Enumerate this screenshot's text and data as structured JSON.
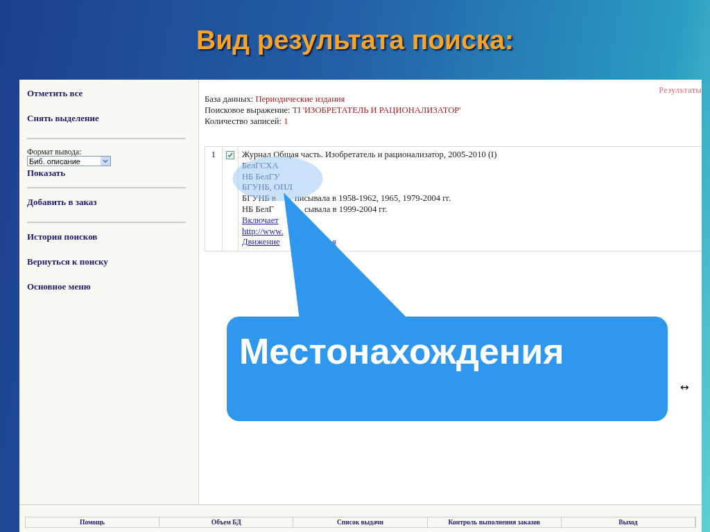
{
  "slide": {
    "title": "Вид результата поиска:"
  },
  "sidebar": {
    "items": [
      {
        "kind": "link",
        "label": "Отметить все"
      },
      {
        "kind": "link",
        "label": "Снять выделение"
      },
      {
        "kind": "divider"
      },
      {
        "kind": "select",
        "label": "Формат вывода:",
        "value": "Биб. описание"
      },
      {
        "kind": "action",
        "label": "Показать"
      },
      {
        "kind": "divider"
      },
      {
        "kind": "link",
        "label": "Добавить в заказ"
      },
      {
        "kind": "divider"
      },
      {
        "kind": "link",
        "label": "История поисков"
      },
      {
        "kind": "link",
        "label": "Вернуться к поиску"
      },
      {
        "kind": "link",
        "label": "Основное меню"
      }
    ]
  },
  "main": {
    "corner_link": "Результаты",
    "info": [
      {
        "label": "База данных:",
        "value": "Периодические издания"
      },
      {
        "label": "Поисковое выражение:",
        "value": "TI 'ИЗОБРЕТАТЕЛЬ И РАЦИОНАЛИЗАТОР'"
      },
      {
        "label": "Количество записей:",
        "value": "1"
      }
    ],
    "results": [
      {
        "number": "1",
        "checked": true,
        "lines": [
          {
            "kind": "title",
            "parts": [
              "Журнал Общая часть. Изобретатель и рационализатор, 2005-2010 (I)"
            ]
          },
          {
            "kind": "location",
            "parts": [
              "БелГСХА"
            ]
          },
          {
            "kind": "location",
            "parts": [
              "НБ БелГУ"
            ]
          },
          {
            "kind": "location",
            "parts": [
              "БГУНБ, ОПЛ"
            ]
          },
          {
            "kind": "note",
            "parts": [
              "БГУНБ в",
              "писывала в 1958-1962, 1965, 1979-2004 гг."
            ]
          },
          {
            "kind": "note",
            "parts": [
              "НБ БелГ",
              "сывала в 1999-2004 гг."
            ]
          },
          {
            "kind": "link",
            "parts": [
              "Включает"
            ]
          },
          {
            "kind": "link",
            "parts": [
              "http://www."
            ]
          },
          {
            "kind": "link",
            "parts": [
              "Движение",
              "я"
            ]
          }
        ]
      }
    ],
    "resize_glyph": "↔"
  },
  "footer": {
    "items": [
      "Помощь",
      "Объем БД",
      "Список выдачи",
      "Контроль выполнения заказов",
      "Выход"
    ]
  },
  "callout": {
    "text": "Местонахождения"
  }
}
